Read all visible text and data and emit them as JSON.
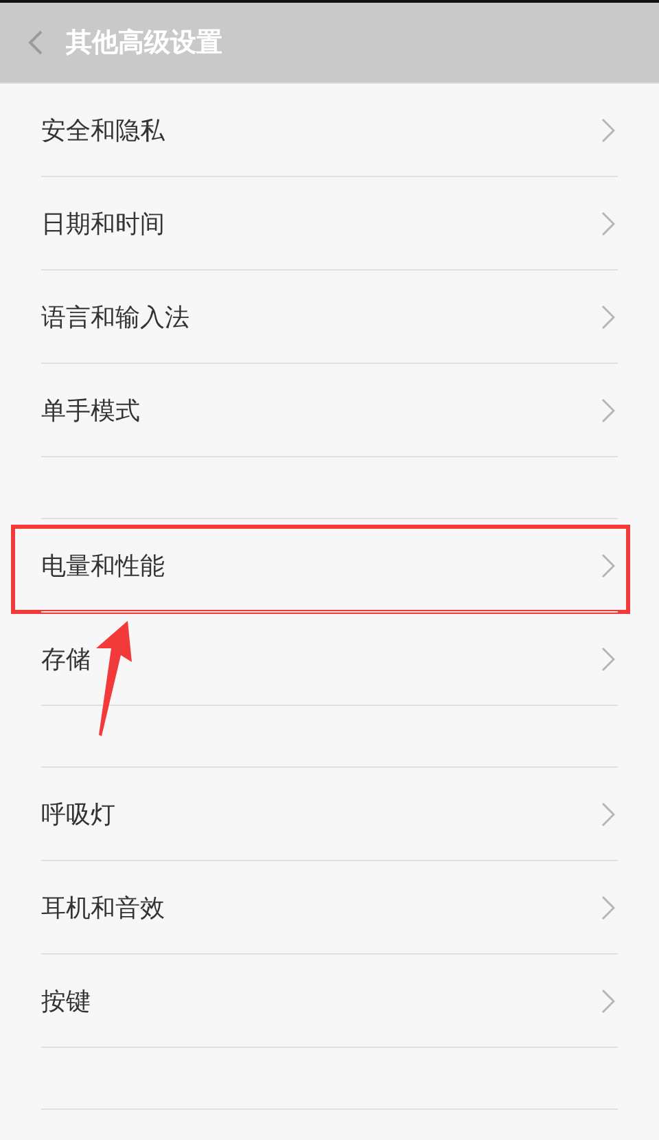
{
  "header": {
    "title": "其他高级设置"
  },
  "rows": [
    {
      "kind": "item",
      "label": "安全和隐私",
      "highlighted": false
    },
    {
      "kind": "item",
      "label": "日期和时间",
      "highlighted": false
    },
    {
      "kind": "item",
      "label": "语言和输入法",
      "highlighted": false
    },
    {
      "kind": "item",
      "label": "单手模式",
      "highlighted": false
    },
    {
      "kind": "spacer"
    },
    {
      "kind": "item",
      "label": "电量和性能",
      "highlighted": true
    },
    {
      "kind": "item",
      "label": "存储",
      "highlighted": false
    },
    {
      "kind": "spacer"
    },
    {
      "kind": "item",
      "label": "呼吸灯",
      "highlighted": false
    },
    {
      "kind": "item",
      "label": "耳机和音效",
      "highlighted": false
    },
    {
      "kind": "item",
      "label": "按键",
      "highlighted": false
    },
    {
      "kind": "spacer"
    }
  ]
}
